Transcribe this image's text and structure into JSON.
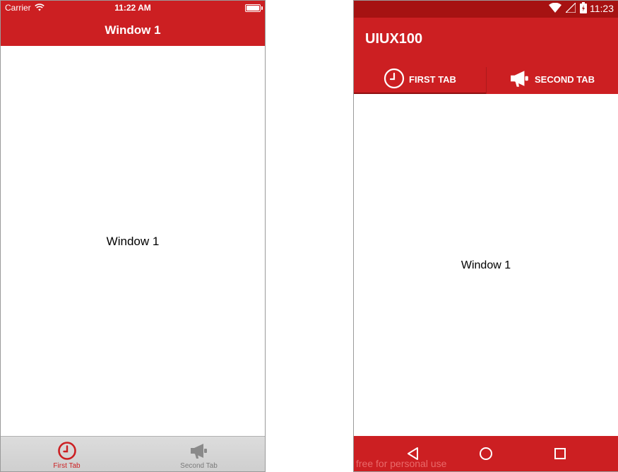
{
  "ios": {
    "status": {
      "carrier": "Carrier",
      "time": "11:22 AM"
    },
    "nav_title": "Window 1",
    "content_label": "Window 1",
    "tabs": [
      {
        "label": "First Tab",
        "icon": "clock-icon",
        "selected": true
      },
      {
        "label": "Second Tab",
        "icon": "megaphone-icon",
        "selected": false
      }
    ]
  },
  "android": {
    "status": {
      "time": "11:23"
    },
    "app_title": "UIUX100",
    "tabs": [
      {
        "label": "FIRST TAB",
        "icon": "clock-icon",
        "selected": true
      },
      {
        "label": "SECOND TAB",
        "icon": "megaphone-icon",
        "selected": false
      }
    ],
    "content_label": "Window 1",
    "nav_buttons": [
      "back-icon",
      "home-icon",
      "recents-icon"
    ],
    "watermark": "free for personal use"
  },
  "colors": {
    "brand_red": "#cc1f22",
    "status_dark_red": "#a61212",
    "ios_tab_inactive": "#7a7a7a"
  }
}
